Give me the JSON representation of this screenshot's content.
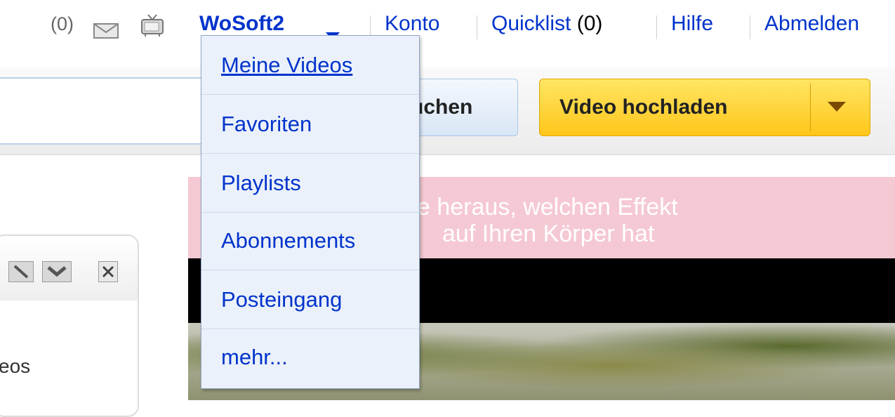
{
  "header": {
    "mail_count": "(0)",
    "mail_icon": "envelope-icon",
    "tv_icon": "tv-icon",
    "username": "WoSoft2",
    "links": {
      "konto": "Konto",
      "quicklist": "Quicklist",
      "quicklist_count": "(0)",
      "hilfe": "Hilfe",
      "abmelden": "Abmelden"
    }
  },
  "search": {
    "button_label": "uchen"
  },
  "upload": {
    "label": "Video hochladen"
  },
  "user_menu": {
    "items": [
      {
        "label": "Meine Videos"
      },
      {
        "label": "Favoriten"
      },
      {
        "label": "Playlists"
      },
      {
        "label": "Abonnements"
      },
      {
        "label": "Posteingang"
      },
      {
        "label": "mehr..."
      }
    ]
  },
  "promo": {
    "line1": "e heraus, welchen Effekt",
    "line2": "auf Ihren Körper hat"
  },
  "widget": {
    "text": "eos"
  },
  "colors": {
    "link": "#0033cc",
    "upload_bg": "#ffc61a",
    "promo_bg": "#f5c9d3",
    "menu_bg": "#ebf1fa"
  }
}
